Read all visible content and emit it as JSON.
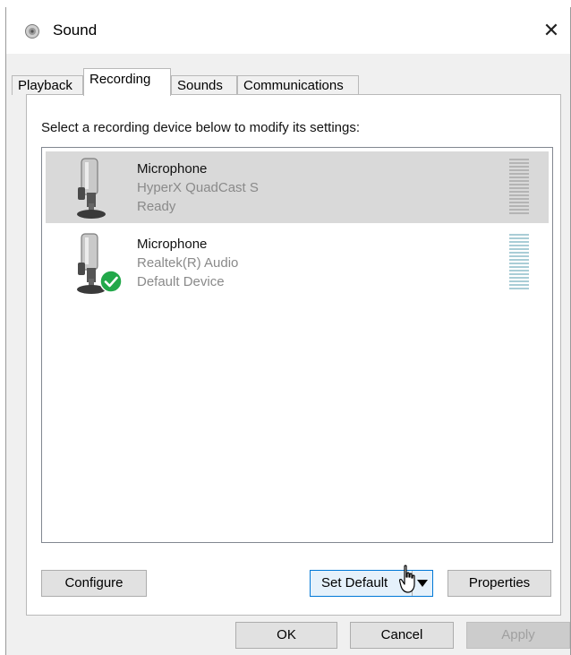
{
  "window": {
    "title": "Sound",
    "close_glyph": "✕"
  },
  "tabs": [
    {
      "label": "Playback",
      "active": false
    },
    {
      "label": "Recording",
      "active": true
    },
    {
      "label": "Sounds",
      "active": false
    },
    {
      "label": "Communications",
      "active": false
    }
  ],
  "recording": {
    "instruction": "Select a recording device below to modify its settings:",
    "devices": [
      {
        "name": "Microphone",
        "driver": "HyperX QuadCast S",
        "status": "Ready",
        "selected": true,
        "default": false
      },
      {
        "name": "Microphone",
        "driver": "Realtek(R) Audio",
        "status": "Default Device",
        "selected": false,
        "default": true
      }
    ]
  },
  "panel_buttons": {
    "configure": "Configure",
    "set_default": "Set Default",
    "properties": "Properties"
  },
  "dialog_buttons": {
    "ok": "OK",
    "cancel": "Cancel",
    "apply": "Apply"
  },
  "icons": {
    "title": "speaker-icon",
    "device": "microphone-icon",
    "default_badge": "check-icon",
    "dropdown": "triangle-down-icon",
    "cursor": "mouse-pointer-icon"
  },
  "colors": {
    "selected_row": "#d9d9d9",
    "default_badge": "#22a84a",
    "focus_border": "#0078d7",
    "level_meter": "#a9cdd6"
  }
}
